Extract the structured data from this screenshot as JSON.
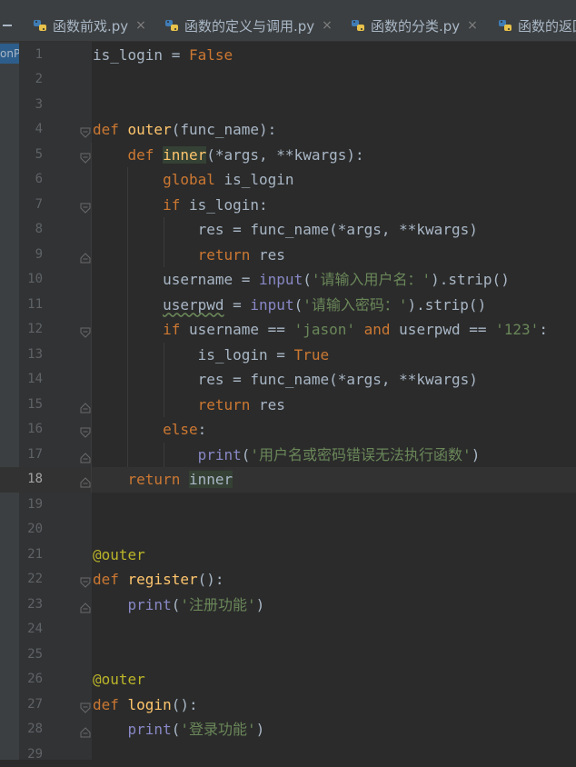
{
  "tabs": [
    {
      "label": "函数前戏.py",
      "close": "×"
    },
    {
      "label": "函数的定义与调用.py",
      "close": "×"
    },
    {
      "label": "函数的分类.py",
      "close": "×"
    },
    {
      "label": "函数的返回",
      "close": ""
    }
  ],
  "side_label": "onP",
  "current_line": 18,
  "lines": [
    {
      "n": "1",
      "tokens": [
        {
          "t": "is_login = ",
          "c": ""
        },
        {
          "t": "False",
          "c": "kw"
        }
      ]
    },
    {
      "n": "2",
      "tokens": []
    },
    {
      "n": "3",
      "tokens": []
    },
    {
      "n": "4",
      "tokens": [
        {
          "t": "def ",
          "c": "kw"
        },
        {
          "t": "outer",
          "c": "fn"
        },
        {
          "t": "(func_name):",
          "c": ""
        }
      ]
    },
    {
      "n": "5",
      "tokens": [
        {
          "t": "    ",
          "c": ""
        },
        {
          "t": "def ",
          "c": "kw"
        },
        {
          "t": "inner",
          "c": "fn hl"
        },
        {
          "t": "(*args, **kwargs):",
          "c": ""
        }
      ]
    },
    {
      "n": "6",
      "tokens": [
        {
          "t": "        ",
          "c": ""
        },
        {
          "t": "global ",
          "c": "kw"
        },
        {
          "t": "is_login",
          "c": ""
        }
      ]
    },
    {
      "n": "7",
      "tokens": [
        {
          "t": "        ",
          "c": ""
        },
        {
          "t": "if ",
          "c": "kw"
        },
        {
          "t": "is_login:",
          "c": ""
        }
      ]
    },
    {
      "n": "8",
      "tokens": [
        {
          "t": "            res = func_name(*args, **kwargs)",
          "c": ""
        }
      ]
    },
    {
      "n": "9",
      "tokens": [
        {
          "t": "            ",
          "c": ""
        },
        {
          "t": "return ",
          "c": "kw"
        },
        {
          "t": "res",
          "c": ""
        }
      ]
    },
    {
      "n": "10",
      "tokens": [
        {
          "t": "        username = ",
          "c": ""
        },
        {
          "t": "input",
          "c": "bi"
        },
        {
          "t": "(",
          "c": ""
        },
        {
          "t": "'请输入用户名：'",
          "c": "str"
        },
        {
          "t": ").strip()",
          "c": ""
        }
      ]
    },
    {
      "n": "11",
      "tokens": [
        {
          "t": "        ",
          "c": ""
        },
        {
          "t": "userpwd",
          "c": "squig"
        },
        {
          "t": " = ",
          "c": ""
        },
        {
          "t": "input",
          "c": "bi"
        },
        {
          "t": "(",
          "c": ""
        },
        {
          "t": "'请输入密码：'",
          "c": "str"
        },
        {
          "t": ").strip()",
          "c": ""
        }
      ]
    },
    {
      "n": "12",
      "tokens": [
        {
          "t": "        ",
          "c": ""
        },
        {
          "t": "if ",
          "c": "kw"
        },
        {
          "t": "username == ",
          "c": ""
        },
        {
          "t": "'jason'",
          "c": "str"
        },
        {
          "t": " and ",
          "c": "kw"
        },
        {
          "t": "userpwd == ",
          "c": ""
        },
        {
          "t": "'123'",
          "c": "str"
        },
        {
          "t": ":",
          "c": ""
        }
      ]
    },
    {
      "n": "13",
      "tokens": [
        {
          "t": "            is_login = ",
          "c": ""
        },
        {
          "t": "True",
          "c": "kw"
        }
      ]
    },
    {
      "n": "14",
      "tokens": [
        {
          "t": "            res = func_name(*args, **kwargs)",
          "c": ""
        }
      ]
    },
    {
      "n": "15",
      "tokens": [
        {
          "t": "            ",
          "c": ""
        },
        {
          "t": "return ",
          "c": "kw"
        },
        {
          "t": "res",
          "c": ""
        }
      ]
    },
    {
      "n": "16",
      "tokens": [
        {
          "t": "        ",
          "c": ""
        },
        {
          "t": "else",
          "c": "kw"
        },
        {
          "t": ":",
          "c": ""
        }
      ]
    },
    {
      "n": "17",
      "tokens": [
        {
          "t": "            ",
          "c": ""
        },
        {
          "t": "print",
          "c": "bi"
        },
        {
          "t": "(",
          "c": ""
        },
        {
          "t": "'用户名或密码错误无法执行函数'",
          "c": "str"
        },
        {
          "t": ")",
          "c": ""
        }
      ]
    },
    {
      "n": "18",
      "tokens": [
        {
          "t": "    ",
          "c": ""
        },
        {
          "t": "return ",
          "c": "kw"
        },
        {
          "t": "inner",
          "c": "hl"
        }
      ]
    },
    {
      "n": "19",
      "tokens": []
    },
    {
      "n": "20",
      "tokens": []
    },
    {
      "n": "21",
      "tokens": [
        {
          "t": "@outer",
          "c": "dec"
        }
      ]
    },
    {
      "n": "22",
      "tokens": [
        {
          "t": "def ",
          "c": "kw"
        },
        {
          "t": "register",
          "c": "fn"
        },
        {
          "t": "():",
          "c": ""
        }
      ]
    },
    {
      "n": "23",
      "tokens": [
        {
          "t": "    ",
          "c": ""
        },
        {
          "t": "print",
          "c": "bi"
        },
        {
          "t": "(",
          "c": ""
        },
        {
          "t": "'注册功能'",
          "c": "str"
        },
        {
          "t": ")",
          "c": ""
        }
      ]
    },
    {
      "n": "24",
      "tokens": []
    },
    {
      "n": "25",
      "tokens": []
    },
    {
      "n": "26",
      "tokens": [
        {
          "t": "@outer",
          "c": "dec"
        }
      ]
    },
    {
      "n": "27",
      "tokens": [
        {
          "t": "def ",
          "c": "kw"
        },
        {
          "t": "login",
          "c": "fn"
        },
        {
          "t": "():",
          "c": ""
        }
      ]
    },
    {
      "n": "28",
      "tokens": [
        {
          "t": "    ",
          "c": ""
        },
        {
          "t": "print",
          "c": "bi"
        },
        {
          "t": "(",
          "c": ""
        },
        {
          "t": "'登录功能'",
          "c": "str"
        },
        {
          "t": ")",
          "c": ""
        }
      ]
    },
    {
      "n": "29",
      "tokens": []
    }
  ],
  "fold_markers": [
    {
      "line": 4,
      "type": "open"
    },
    {
      "line": 5,
      "type": "open"
    },
    {
      "line": 7,
      "type": "open"
    },
    {
      "line": 9,
      "type": "close"
    },
    {
      "line": 12,
      "type": "open"
    },
    {
      "line": 15,
      "type": "close"
    },
    {
      "line": 16,
      "type": "open"
    },
    {
      "line": 17,
      "type": "close"
    },
    {
      "line": 18,
      "type": "close"
    },
    {
      "line": 22,
      "type": "open"
    },
    {
      "line": 23,
      "type": "close"
    },
    {
      "line": 27,
      "type": "open"
    },
    {
      "line": 28,
      "type": "close"
    }
  ],
  "colors": {
    "background": "#2b2b2b",
    "keyword": "#cc7832",
    "function": "#ffc66d",
    "string": "#6a8759",
    "builtin": "#8888c6",
    "decorator": "#bbb529",
    "text": "#a9b7c6"
  }
}
